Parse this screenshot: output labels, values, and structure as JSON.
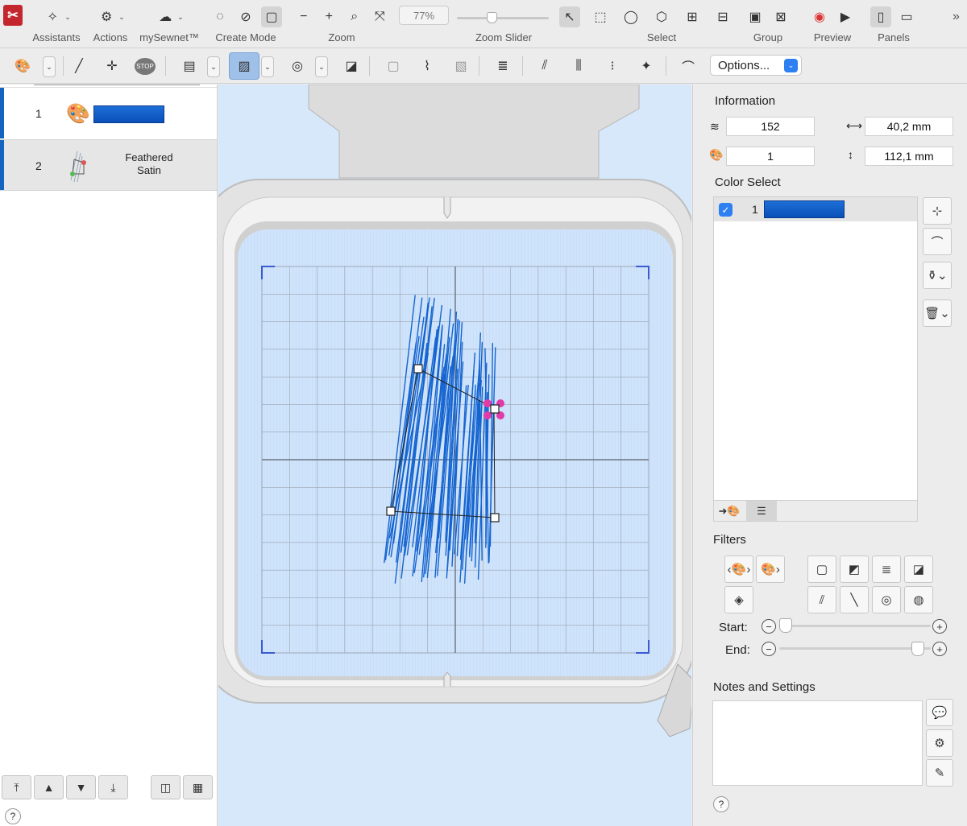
{
  "app": {
    "logo": "software-logo"
  },
  "toolbar": {
    "groups": {
      "assistants": "Assistants",
      "actions": "Actions",
      "mysewnet": "mySewnet™",
      "create_mode": "Create Mode",
      "zoom": "Zoom",
      "zoom_slider": "Zoom Slider",
      "select": "Select",
      "group": "Group",
      "preview": "Preview",
      "panels": "Panels"
    },
    "zoom_value": "77%",
    "zoom_slider_fraction": 0.37
  },
  "toolbar2": {
    "options_label": "Options..."
  },
  "layers": [
    {
      "number": "1",
      "type": "color-palette",
      "swatch_color": "#1565d0"
    },
    {
      "number": "2",
      "label": "Feathered Satin",
      "type": "feathered-satin"
    }
  ],
  "information": {
    "title": "Information",
    "stitches": "152",
    "width": "40,2 mm",
    "colors": "1",
    "height": "112,1 mm"
  },
  "color_select": {
    "title": "Color Select",
    "items": [
      {
        "number": "1",
        "checked": true,
        "color": "#1565d0"
      }
    ]
  },
  "filters": {
    "title": "Filters",
    "start_label": "Start:",
    "end_label": "End:",
    "start_fraction": 0.0,
    "end_fraction": 1.0
  },
  "notes": {
    "title": "Notes and Settings"
  },
  "help": "?",
  "colors": {
    "accent": "#2d7ff2",
    "thread": "#1565d0",
    "selection_bar": "#1565c0",
    "canvas": "#d7e8fb"
  }
}
